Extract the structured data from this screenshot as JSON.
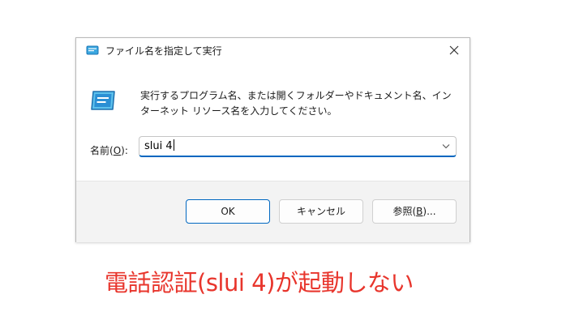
{
  "dialog": {
    "title": "ファイル名を指定して実行",
    "description": "実行するプログラム名、または開くフォルダーやドキュメント名、インターネット リソース名を入力してください。",
    "open_label_prefix": "名前(",
    "open_label_key": "O",
    "open_label_suffix": "):",
    "command_value": "slui 4",
    "buttons": {
      "ok": "OK",
      "cancel": "キャンセル",
      "browse_prefix": "参照(",
      "browse_key": "B",
      "browse_suffix": ")..."
    }
  },
  "caption": "電話認証(slui 4)が起動しない",
  "colors": {
    "accent": "#0067c0",
    "caption": "#e8352c",
    "button_bar": "#f3f3f3"
  },
  "icons": {
    "title": "run-icon",
    "close": "close-icon",
    "dropdown": "chevron-down-icon",
    "main": "run-icon"
  }
}
